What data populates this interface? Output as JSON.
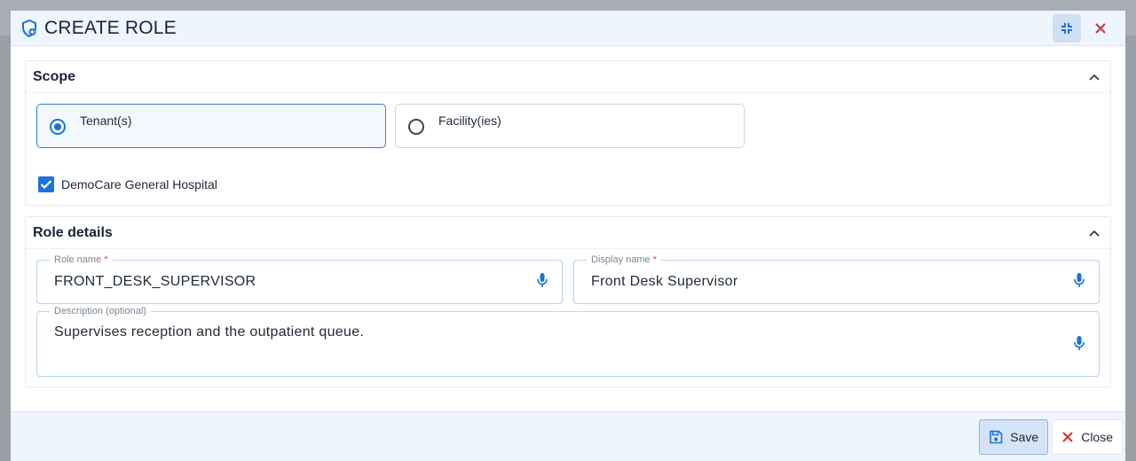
{
  "modal": {
    "title": "CREATE ROLE"
  },
  "scope": {
    "title": "Scope",
    "options": [
      {
        "label": "Tenant(s)",
        "selected": true
      },
      {
        "label": "Facility(ies)",
        "selected": false
      }
    ],
    "checkbox": {
      "label": "DemoCare General Hospital",
      "checked": true
    }
  },
  "role_details": {
    "title": "Role details",
    "role_name": {
      "label": "Role name",
      "required_mark": "*",
      "value": "FRONT_DESK_SUPERVISOR"
    },
    "display_name": {
      "label": "Display name",
      "required_mark": "*",
      "value": "Front Desk Supervisor"
    },
    "description": {
      "label": "Description (optional)",
      "value": "Supervises reception and the outpatient queue."
    }
  },
  "footer": {
    "save_label": "Save",
    "close_label": "Close"
  },
  "colors": {
    "accent": "#1a73d9",
    "close_red": "#d32f2f"
  }
}
